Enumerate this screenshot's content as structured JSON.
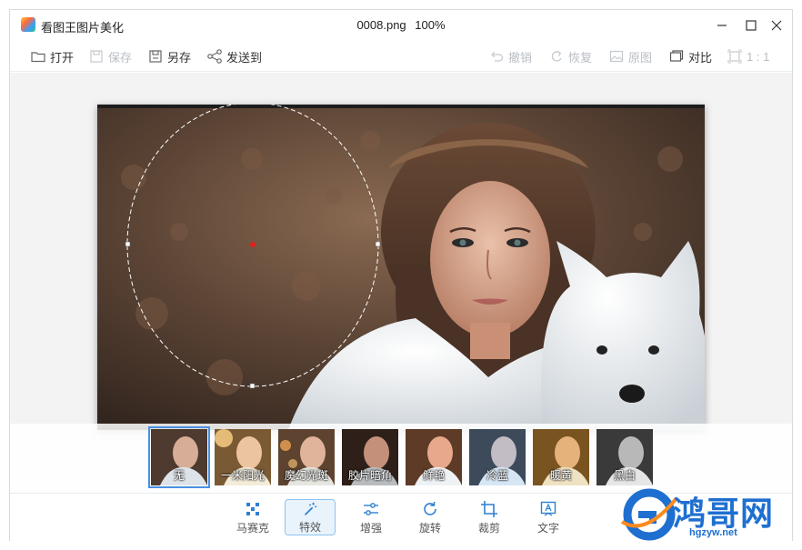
{
  "app": {
    "title": "看图王图片美化"
  },
  "file": {
    "name": "0008.png",
    "zoom": "100%"
  },
  "toolbar": {
    "open": "打开",
    "save": "保存",
    "save_as": "另存",
    "send_to": "发送到",
    "undo": "撤销",
    "redo": "恢复",
    "original": "原图",
    "compare": "对比",
    "actual_size": "1 : 1"
  },
  "filters": [
    {
      "label": "无",
      "selected": true
    },
    {
      "label": "一米阳光",
      "selected": false
    },
    {
      "label": "魔幻光斑",
      "selected": false
    },
    {
      "label": "胶片暗角",
      "selected": false
    },
    {
      "label": "鲜艳",
      "selected": false
    },
    {
      "label": "冷蓝",
      "selected": false
    },
    {
      "label": "暖黄",
      "selected": false
    },
    {
      "label": "黑白",
      "selected": false
    }
  ],
  "bottom_tools": {
    "mosaic": "马赛克",
    "effects": "特效",
    "enhance": "增强",
    "rotate": "旋转",
    "crop": "裁剪",
    "text": "文字"
  },
  "watermark": {
    "text": "鸿哥网",
    "url": "hgzyw.net"
  },
  "colors": {
    "accent": "#4a90e2",
    "icon_blue": "#2f80d1",
    "brand": "#1e6fd0"
  }
}
